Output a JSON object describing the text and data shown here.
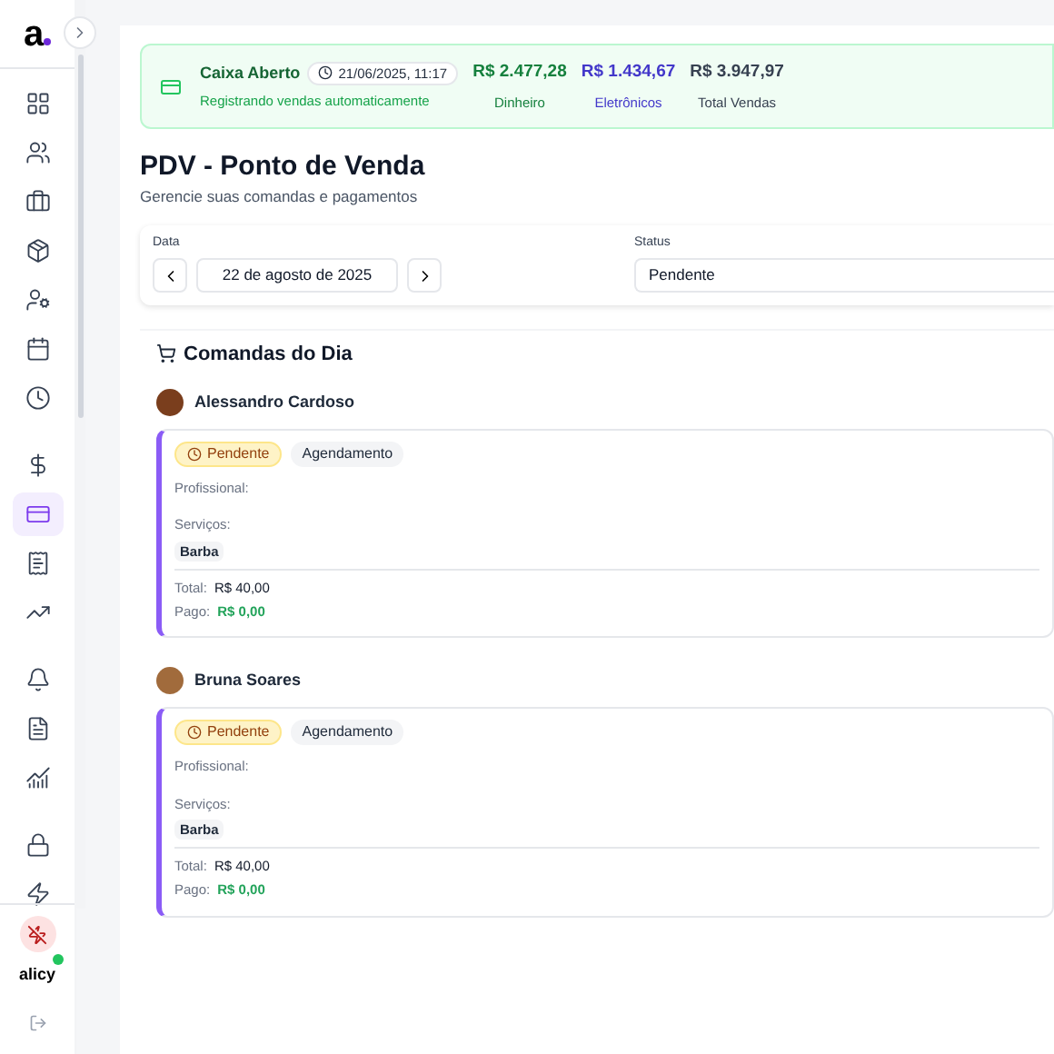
{
  "sidebar": {
    "logo": "a",
    "nav_groups": [
      [
        {
          "selected": false
        },
        {
          "selected": false
        },
        {
          "selected": false
        },
        {
          "selected": false
        },
        {
          "selected": false
        },
        {
          "selected": false
        },
        {
          "selected": false
        }
      ],
      [
        {
          "selected": false
        },
        {
          "selected": true
        },
        {
          "selected": false
        },
        {
          "selected": false
        }
      ],
      [
        {
          "selected": false
        },
        {
          "selected": false
        },
        {
          "selected": false
        }
      ],
      [
        {
          "selected": false
        },
        {
          "selected": false
        }
      ]
    ],
    "brand": "alicy",
    "online": true
  },
  "cash_banner": {
    "title": "Caixa Aberto",
    "opened_at": "21/06/2025, 11:17",
    "subtitle": "Registrando vendas automaticamente",
    "totals": [
      {
        "value": "R$ 2.477,28",
        "label": "Dinheiro",
        "color": "#15803d"
      },
      {
        "value": "R$ 1.434,67",
        "label": "Eletrônicos",
        "color": "#4338ca"
      },
      {
        "value": "R$ 3.947,97",
        "label": "Total Vendas",
        "color": "#374151"
      }
    ]
  },
  "page": {
    "title": "PDV - Ponto de Venda",
    "subtitle": "Gerencie suas comandas e pagamentos"
  },
  "filters": {
    "date_label": "Data",
    "date": "22 de agosto de 2025",
    "status_label": "Status",
    "status": "Pendente"
  },
  "orders": {
    "title": "Comandas do Dia",
    "items": [
      {
        "client": "Alessandro Cardoso",
        "status": "Pendente",
        "type": "Agendamento",
        "professional_label": "Profissional:",
        "services_label": "Serviços:",
        "services": [
          "Barba"
        ],
        "total_label": "Total:",
        "total": "R$ 40,00",
        "paid_label": "Pago:",
        "paid": "R$ 0,00"
      },
      {
        "client": "Bruna Soares",
        "status": "Pendente",
        "type": "Agendamento",
        "professional_label": "Profissional:",
        "services_label": "Serviços:",
        "services": [
          "Barba"
        ],
        "total_label": "Total:",
        "total": "R$ 40,00",
        "paid_label": "Pago:",
        "paid": "R$ 0,00"
      }
    ]
  }
}
